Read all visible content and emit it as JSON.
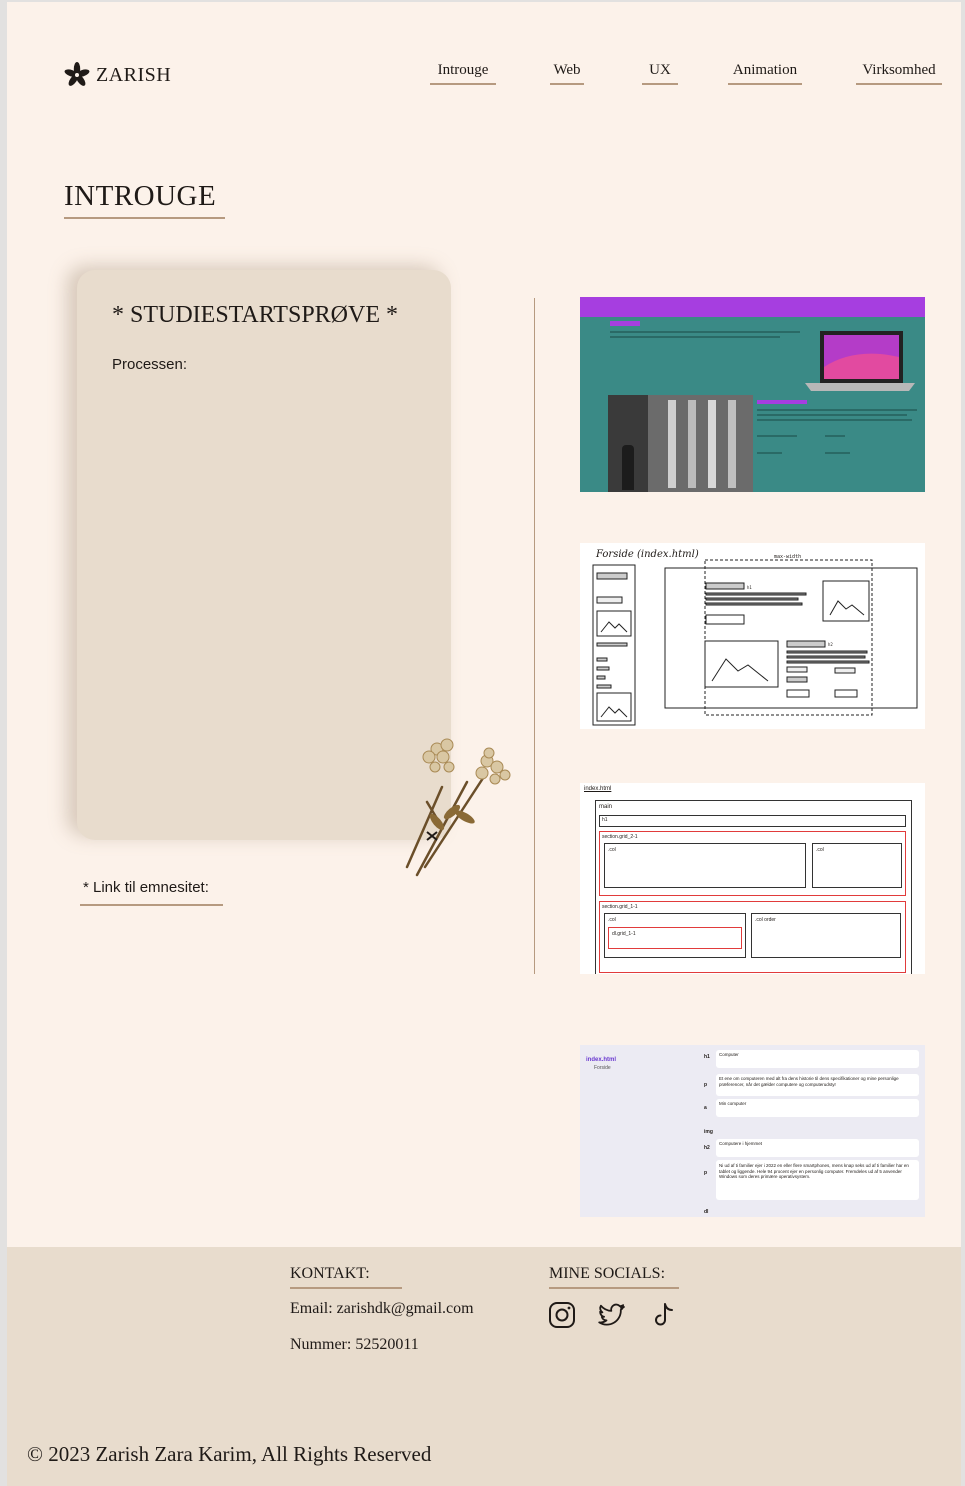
{
  "header": {
    "logo_text": "ZARISH",
    "nav": [
      "Introuge",
      "Web",
      "UX",
      "Animation",
      "Virksomhed"
    ]
  },
  "main": {
    "title": "INTROUGE",
    "card": {
      "title": "* STUDIESTARTSPRØVE *",
      "subtitle": "Processen:"
    },
    "link_label": "* Link til emnesitet:"
  },
  "thumbnails": {
    "t2_label": "Forside (index.html)",
    "t2_maxw": "max-width",
    "t2_h1": "h1",
    "t2_h2": "h2",
    "t3_file": "index.html",
    "t3_main": "main",
    "t3_h1": "h1",
    "t3_section1": "section.grid_2-1",
    "t3_col": ".col",
    "t3_col2": ".col",
    "t3_section2": "section.grid_1-1",
    "t3_col3": ".col",
    "t3_col_order": ".col order",
    "t3_dl": "dl.grid_1-1",
    "t4_file": "index.html",
    "t4_page": "Forside",
    "t4_rows": [
      {
        "tag": "h1",
        "text": "Computer"
      },
      {
        "tag": "p",
        "text": "Et ene om computeren med alt fra dens historie til dens specifikationer og mine personlige præferencer, når det gælder computere og computerudstyr"
      },
      {
        "tag": "a",
        "text": "Min computer"
      },
      {
        "tag": "img",
        "text": ""
      },
      {
        "tag": "h2",
        "text": "Computere i hjemmet"
      },
      {
        "tag": "p",
        "text": "Ni ud af ti familier ejer i 2022 en eller flere smartphones, mens knap seks ud af ti familier har en tablet og liggende. Hele 94 procent ejer en personlig computer. Fremdeles ud af 5 anvender Windows som deres primære operativsystem."
      },
      {
        "tag": "dl",
        "text": ""
      }
    ]
  },
  "footer": {
    "contact_heading": "KONTAKT:",
    "email": "Email: zarishdk@gmail.com",
    "phone": "Nummer: 52520011",
    "socials_heading": "MINE SOCIALS:",
    "socials": [
      "instagram-icon",
      "twitter-icon",
      "tiktok-icon"
    ],
    "copyright": "© 2023 Zarish Zara Karim, All Rights Reserved"
  },
  "colors": {
    "background": "#fcf2ea",
    "card": "#e8dccd",
    "accent_line": "#b69a80",
    "thumbnail_teal": "#3a8a86",
    "thumbnail_purple": "#a63ee0"
  }
}
